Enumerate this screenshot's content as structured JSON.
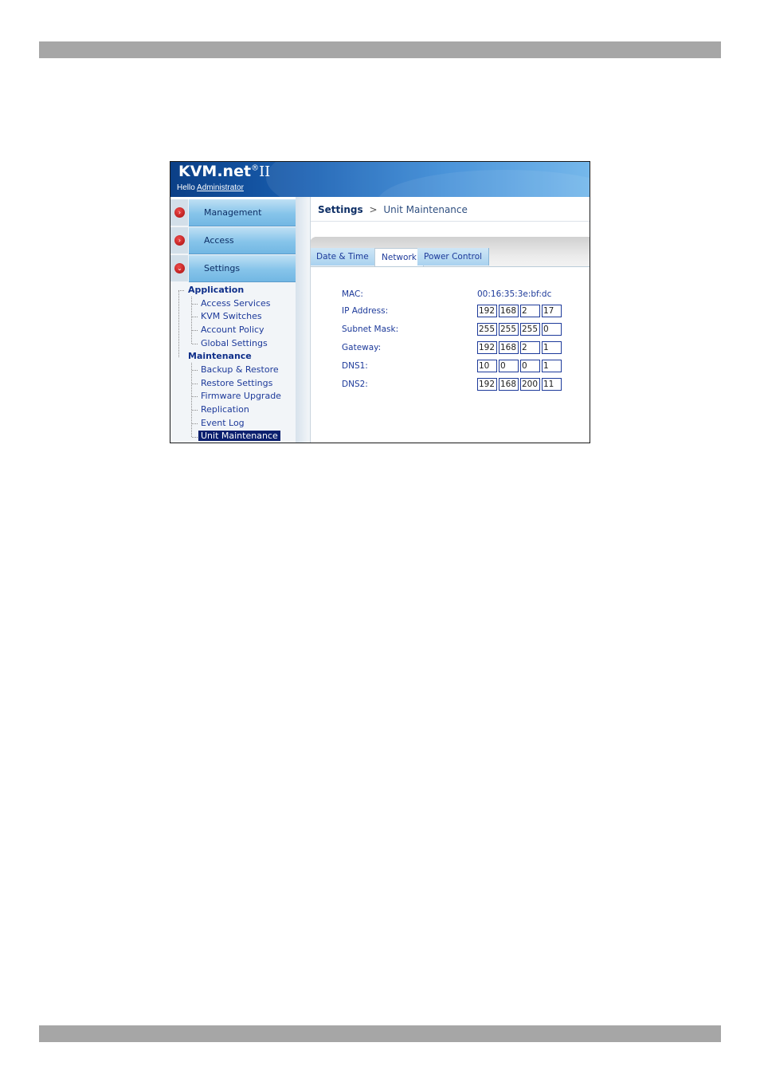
{
  "header": {
    "brand": "KVM.net",
    "brand_reg": "®",
    "brand_suffix": "II",
    "greeting": "Hello",
    "user": "Administrator"
  },
  "nav": {
    "buttons": [
      {
        "label": "Management",
        "glyph": "›"
      },
      {
        "label": "Access",
        "glyph": "›"
      },
      {
        "label": "Settings",
        "glyph": "⌄"
      }
    ]
  },
  "tree": {
    "application": {
      "title": "Application",
      "items": [
        "Access Services",
        "KVM Switches",
        "Account Policy",
        "Global Settings"
      ]
    },
    "maintenance": {
      "title": "Maintenance",
      "items": [
        "Backup & Restore",
        "Restore Settings",
        "Firmware Upgrade",
        "Replication",
        "Event Log",
        "Unit Maintenance"
      ]
    }
  },
  "breadcrumb": {
    "root": "Settings",
    "separator": ">",
    "current": "Unit Maintenance"
  },
  "tabs": [
    "Date & Time",
    "Network",
    "Power Control"
  ],
  "form": {
    "mac_label": "MAC:",
    "mac_value": "00:16:35:3e:bf:dc",
    "ip_label": "IP Address:",
    "ip": [
      "192",
      "168",
      "2",
      "17"
    ],
    "subnet_label": "Subnet Mask:",
    "subnet": [
      "255",
      "255",
      "255",
      "0"
    ],
    "gateway_label": "Gateway:",
    "gateway": [
      "192",
      "168",
      "2",
      "1"
    ],
    "dns1_label": "DNS1:",
    "dns1": [
      "10",
      "0",
      "0",
      "1"
    ],
    "dns2_label": "DNS2:",
    "dns2": [
      "192",
      "168",
      "200",
      "11"
    ]
  }
}
